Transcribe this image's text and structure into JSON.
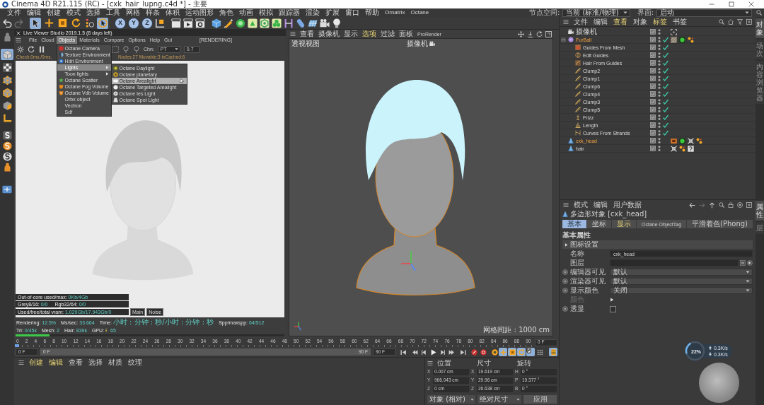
{
  "window": {
    "title": "Cinema 4D R21.115 (RC) - [cxk_hair_lupng.c4d *] - 主要"
  },
  "menu_bar": {
    "items": [
      "文件",
      "编辑",
      "创建",
      "模式",
      "选择",
      "工具",
      "网格",
      "样条",
      "体积",
      "运动图形",
      "角色",
      "动画",
      "模拟",
      "跟踪器",
      "渲染",
      "扩展",
      "窗口",
      "帮助",
      "Ornatrix",
      "Octane"
    ],
    "node_space": {
      "label": "节点空间:",
      "value": "当前 (标准/物理)"
    },
    "layout": {
      "label": "界面:",
      "value": "启动"
    }
  },
  "toolbar": {
    "history": [
      {
        "kind": "undo",
        "disabled": false
      },
      {
        "kind": "redo",
        "disabled": true
      }
    ],
    "tools": [
      {
        "kind": "select",
        "selected": true
      },
      {
        "kind": "move",
        "selected": false
      },
      {
        "kind": "scale",
        "selected": false
      },
      {
        "kind": "rotate",
        "selected": false
      },
      {
        "kind": "recent",
        "selected": false
      },
      {
        "kind": "live-select",
        "selected": true
      }
    ],
    "axes": [
      {
        "label": "X",
        "selected": true
      },
      {
        "label": "Y",
        "selected": true
      },
      {
        "label": "Z",
        "selected": true
      }
    ]
  },
  "mode_bar": {
    "modes": [
      {
        "kind": "model",
        "selected": true
      },
      {
        "kind": "texture",
        "selected": false
      },
      {
        "kind": "points",
        "selected": false
      },
      {
        "kind": "edges",
        "selected": false
      },
      {
        "kind": "polygons",
        "selected": false
      },
      {
        "kind": "axis",
        "selected": false
      }
    ]
  },
  "live_viewer": {
    "title": "Live Viewer Studio 2019.1.5 (8 days left)",
    "menu": [
      {
        "label": "File",
        "selected": false
      },
      {
        "label": "Cloud",
        "selected": false
      },
      {
        "label": "Objects",
        "selected": true
      },
      {
        "label": "Materials",
        "selected": false
      },
      {
        "label": "Compare",
        "selected": false
      },
      {
        "label": "Options",
        "selected": false
      },
      {
        "label": "Help",
        "selected": false
      },
      {
        "label": "Gui",
        "selected": false
      }
    ],
    "status": "[RENDERING]",
    "channel": {
      "label": "Chn:",
      "value": "PT"
    },
    "gamma": "0.7",
    "info_left": "Check:0ms./0ms.",
    "info_right": "Nodes:27 Movable:3 txCached:6",
    "objects_menu": [
      {
        "kind": "octane-camera",
        "label": "Octane Camera",
        "selected": false,
        "has_submenu": false
      },
      {
        "kind": "texture-env",
        "label": "Texture Environment",
        "selected": false,
        "has_submenu": false
      },
      {
        "kind": "hdri-env",
        "label": "Hdri Environment",
        "selected": false,
        "has_submenu": false
      },
      {
        "kind": "plain",
        "label": "Lights",
        "selected": true,
        "has_submenu": true,
        "submenu": [
          {
            "kind": "daylight",
            "label": "Octane Daylight",
            "selected": false
          },
          {
            "kind": "planetary",
            "label": "Octane planetary",
            "selected": false
          },
          {
            "kind": "arealight",
            "label": "Octane Arealight",
            "selected": true
          },
          {
            "kind": "targeted",
            "label": "Octane Targeted Arealight",
            "selected": false
          },
          {
            "kind": "ies",
            "label": "Octane Ies Light",
            "selected": false
          },
          {
            "kind": "spot",
            "label": "Octane Spot Light",
            "selected": false
          }
        ]
      },
      {
        "kind": "plain",
        "label": "Toon lights",
        "selected": false,
        "has_submenu": true
      },
      {
        "kind": "scatter",
        "label": "Octane Scatter",
        "selected": false,
        "has_submenu": false
      },
      {
        "kind": "fog",
        "label": "Octane Fog Volume",
        "selected": false,
        "has_submenu": false
      },
      {
        "kind": "vdb",
        "label": "Octane Vdb Volume",
        "selected": false,
        "has_submenu": false
      },
      {
        "kind": "plain",
        "label": "Orbx object",
        "selected": false,
        "has_submenu": false
      },
      {
        "kind": "plain",
        "label": "Vectron",
        "selected": false,
        "has_submenu": false
      },
      {
        "kind": "plain",
        "label": "Sdf",
        "selected": false,
        "has_submenu": false
      }
    ],
    "memory": [
      [
        {
          "label": "Out-of-core used/max:",
          "value": "0Kb/4Gb"
        }
      ],
      [
        {
          "label": "Grey8/16:",
          "value": "0/0"
        },
        {
          "label": "Rgb32/64:",
          "value": "0/0"
        }
      ],
      [
        {
          "label": "Used/free/total vram:",
          "value": "1.029Gb/17.943Gb/0"
        }
      ]
    ],
    "view_buttons": [
      "Main",
      "Noise"
    ],
    "render_stats": [
      {
        "kind": "text",
        "label": "Rendering:",
        "value": "12.5%"
      },
      {
        "kind": "text",
        "label": "Ms/sec:",
        "value": "33.664"
      },
      {
        "kind": "text",
        "label": "Time:",
        "value": "小时 : 分钟 : 秒/小时 : 分钟 : 秒"
      },
      {
        "kind": "text",
        "label": "Spp/maxspp:",
        "value": "64/512"
      },
      {
        "kind": "text",
        "label": "Tri:",
        "value": "0/45k"
      },
      {
        "kind": "text",
        "label": "Mesh:",
        "value": "2"
      },
      {
        "kind": "text",
        "label": "Hair:",
        "value": "839k"
      },
      {
        "kind": "meter",
        "label": "GPU:",
        "value": "65"
      }
    ],
    "progress": {
      "level": 0.125
    }
  },
  "viewport": {
    "menu": [
      {
        "label": "查看",
        "highlighted": false
      },
      {
        "label": "摄像机",
        "highlighted": false
      },
      {
        "label": "显示",
        "highlighted": false
      },
      {
        "label": "选项",
        "highlighted": true
      },
      {
        "label": "过滤",
        "highlighted": false
      },
      {
        "label": "面板",
        "highlighted": false
      },
      {
        "label": "ProRender",
        "highlighted": false
      }
    ],
    "view_name": "透视视图",
    "camera": "摄像机",
    "grid_spacing": "网格间距 : 1000 cm"
  },
  "object_manager": {
    "menu": [
      {
        "label": "文件",
        "highlighted": false
      },
      {
        "label": "编辑",
        "highlighted": false
      },
      {
        "label": "查看",
        "highlighted": true
      },
      {
        "label": "对象",
        "highlighted": false
      },
      {
        "label": "标签",
        "highlighted": true
      },
      {
        "label": "书签",
        "highlighted": false
      }
    ],
    "objects": [
      {
        "kind": "camera",
        "name": "摄像机",
        "selected": false,
        "enabled": false,
        "tags": [
          {
            "kind": "corners"
          }
        ]
      },
      {
        "kind": "furball",
        "name": "FurBall",
        "selected": true,
        "enabled": true,
        "expanded": true,
        "tags": [
          {
            "kind": "hatched"
          },
          {
            "kind": "disc"
          },
          {
            "kind": "dots"
          }
        ],
        "children": [
          {
            "kind": "guides",
            "name": "Guides From Mesh",
            "selected": false,
            "enabled": true
          },
          {
            "kind": "edit-guides",
            "name": "Edit Guides",
            "selected": false,
            "enabled": true
          },
          {
            "kind": "hair-from-guides",
            "name": "Hair From Guides",
            "selected": false,
            "enabled": true
          },
          {
            "kind": "clump",
            "name": "Clump2",
            "selected": false,
            "enabled": true
          },
          {
            "kind": "clump",
            "name": "Clump1",
            "selected": false,
            "enabled": true
          },
          {
            "kind": "clump",
            "name": "Clump6",
            "selected": false,
            "enabled": true
          },
          {
            "kind": "clump",
            "name": "Clump4",
            "selected": false,
            "enabled": true
          },
          {
            "kind": "clump",
            "name": "Clump3",
            "selected": false,
            "enabled": true
          },
          {
            "kind": "clump",
            "name": "Clump5",
            "selected": false,
            "enabled": true
          },
          {
            "kind": "frizz",
            "name": "Frizz",
            "selected": false,
            "enabled": true
          },
          {
            "kind": "length",
            "name": "Length",
            "selected": false,
            "enabled": true
          },
          {
            "kind": "curves",
            "name": "Curves From Strands",
            "selected": false,
            "enabled": true
          }
        ]
      },
      {
        "kind": "polygon",
        "name": "cxk_head",
        "selected": true,
        "enabled": false,
        "tags": [
          {
            "kind": "frame"
          },
          {
            "kind": "disc"
          },
          {
            "kind": "cross"
          },
          {
            "kind": "dots"
          }
        ]
      },
      {
        "kind": "polygon",
        "name": "hair",
        "selected": false,
        "enabled": false,
        "tags": [
          {
            "kind": "cross"
          },
          {
            "kind": "dots"
          },
          {
            "kind": "question"
          }
        ]
      }
    ]
  },
  "side_tabs": {
    "objects": [
      {
        "label": "对象",
        "selected": true
      },
      {
        "label": "场次",
        "selected": false
      },
      {
        "label": "内容浏览器",
        "selected": false
      }
    ],
    "attributes": [
      {
        "label": "属性",
        "selected": true
      },
      {
        "label": "层",
        "selected": false
      }
    ]
  },
  "attributes": {
    "menu": [
      "模式",
      "编辑",
      "用户数据"
    ],
    "title": "多边形对象 [cxk_head]",
    "tabs": [
      {
        "label": "基本",
        "selected": true,
        "highlighted": false
      },
      {
        "label": "坐标",
        "selected": false,
        "highlighted": false
      },
      {
        "label": "显示",
        "selected": false,
        "highlighted": true
      },
      {
        "label": "Octane ObjectTag",
        "selected": false,
        "highlighted": false
      },
      {
        "label": "平滑着色(Phong)",
        "selected": false,
        "highlighted": false
      }
    ],
    "section": "基本属性",
    "group": {
      "label": "图标设置",
      "expanded": false
    },
    "fields": [
      {
        "kind": "text",
        "label": "名称",
        "value": "cxk_head",
        "animatable": false,
        "disabled": false
      },
      {
        "kind": "link",
        "label": "图层",
        "animatable": false,
        "disabled": false
      },
      {
        "kind": "dropdown",
        "label": "编辑器可见",
        "value": "默认",
        "animatable": true,
        "disabled": false
      },
      {
        "kind": "dropdown",
        "label": "渲染器可见",
        "value": "默认",
        "animatable": true,
        "disabled": false
      },
      {
        "kind": "dropdown",
        "label": "显示颜色",
        "value": "关闭",
        "animatable": true,
        "disabled": false
      },
      {
        "kind": "color",
        "label": "颜色",
        "animatable": false,
        "disabled": true
      },
      {
        "kind": "checkbox",
        "label": "透显",
        "checked": false,
        "animatable": true,
        "disabled": false
      }
    ]
  },
  "timeline": {
    "ticks": [
      "0",
      "2",
      "4",
      "6",
      "8",
      "10",
      "12",
      "14",
      "16",
      "18",
      "20",
      "22",
      "24",
      "26",
      "28",
      "30",
      "32",
      "34",
      "36",
      "38",
      "40",
      "42",
      "44",
      "46",
      "48",
      "50",
      "52",
      "54",
      "56",
      "58",
      "60",
      "62",
      "64",
      "66",
      "68",
      "70",
      "72",
      "74",
      "76",
      "78",
      "80",
      "82",
      "84",
      "86",
      "88",
      "90"
    ],
    "playhead": {
      "level": 0
    },
    "current_frame": "0 F",
    "start_frame": "0 F",
    "range_start": "0 F",
    "range_end": "90 F",
    "end_frame": "90 F"
  },
  "transport": {
    "toggles": [
      {
        "kind": "position",
        "selected": true
      },
      {
        "kind": "scale",
        "selected": true
      },
      {
        "kind": "rotation",
        "selected": true
      },
      {
        "kind": "parameter",
        "label": "P",
        "selected": true
      },
      {
        "kind": "point-level",
        "selected": false
      },
      {
        "kind": "timeline",
        "selected": true
      }
    ]
  },
  "material_manager": {
    "menu": [
      {
        "label": "创建",
        "highlighted": true
      },
      {
        "label": "编辑",
        "highlighted": true
      },
      {
        "label": "查看",
        "highlighted": false
      },
      {
        "label": "选择",
        "highlighted": false
      },
      {
        "label": "材质",
        "highlighted": false
      },
      {
        "label": "纹理",
        "highlighted": false
      }
    ]
  },
  "coordinates": {
    "headers": [
      "位置",
      "尺寸",
      "旋转"
    ],
    "rows": [
      [
        {
          "axis": "X",
          "value": "0.007 cm"
        },
        {
          "axis": "X",
          "value": "19.619 cm"
        },
        {
          "axis": "H",
          "value": "0 °"
        }
      ],
      [
        {
          "axis": "Y",
          "value": "966.043 cm"
        },
        {
          "axis": "Y",
          "value": "29.96 cm"
        },
        {
          "axis": "P",
          "value": "19.377 °"
        }
      ],
      [
        {
          "axis": "Z",
          "value": "0 cm"
        },
        {
          "axis": "Z",
          "value": "26.638 cm"
        },
        {
          "axis": "B",
          "value": "0 °"
        }
      ]
    ],
    "modes": [
      "对象 (相对)",
      "绝对尺寸"
    ],
    "apply": "应用"
  },
  "network_widget": {
    "percent": "22%",
    "level": 0.22,
    "upload": "0.3K/s",
    "download": "0.3K/s"
  }
}
